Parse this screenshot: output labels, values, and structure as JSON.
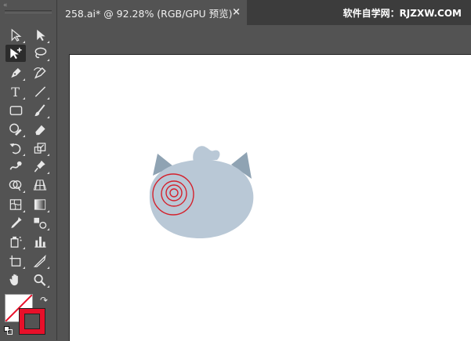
{
  "document_tab": {
    "title": "258.ai* @ 92.28% (RGB/GPU 预览)",
    "close_glyph": "×"
  },
  "watermark": "软件自学网：RJZXW.COM",
  "toolbar": {
    "collapse_glyph": "«",
    "tools": [
      {
        "name": "selection-tool",
        "icon": "arrow-outline-icon",
        "selected": false
      },
      {
        "name": "direct-selection-tool",
        "icon": "arrow-filled-icon",
        "selected": false
      },
      {
        "name": "group-selection-tool",
        "icon": "arrow-plus-icon",
        "selected": true
      },
      {
        "name": "lasso-tool",
        "icon": "lasso-icon",
        "selected": false
      },
      {
        "name": "pen-tool",
        "icon": "pen-icon",
        "selected": false
      },
      {
        "name": "curvature-tool",
        "icon": "curvature-pen-icon",
        "selected": false
      },
      {
        "name": "type-tool",
        "icon": "type-icon",
        "selected": false
      },
      {
        "name": "line-segment-tool",
        "icon": "line-icon",
        "selected": false
      },
      {
        "name": "rectangle-tool",
        "icon": "rectangle-icon",
        "selected": false
      },
      {
        "name": "paintbrush-tool",
        "icon": "brush-icon",
        "selected": false
      },
      {
        "name": "shaper-tool",
        "icon": "shaper-icon",
        "selected": false
      },
      {
        "name": "eraser-tool",
        "icon": "eraser-icon",
        "selected": false
      },
      {
        "name": "rotate-tool",
        "icon": "rotate-icon",
        "selected": false
      },
      {
        "name": "scale-tool",
        "icon": "scale-icon",
        "selected": false
      },
      {
        "name": "warp-tool",
        "icon": "warp-icon",
        "selected": false
      },
      {
        "name": "puppet-warp-tool",
        "icon": "pin-icon",
        "selected": false
      },
      {
        "name": "shape-builder-tool",
        "icon": "shape-builder-icon",
        "selected": false
      },
      {
        "name": "perspective-grid-tool",
        "icon": "perspective-grid-icon",
        "selected": false
      },
      {
        "name": "mesh-tool",
        "icon": "mesh-icon",
        "selected": false
      },
      {
        "name": "gradient-tool",
        "icon": "gradient-icon",
        "selected": false
      },
      {
        "name": "eyedropper-tool",
        "icon": "eyedropper-icon",
        "selected": false
      },
      {
        "name": "blend-tool",
        "icon": "blend-icon",
        "selected": false
      },
      {
        "name": "symbol-sprayer-tool",
        "icon": "symbol-sprayer-icon",
        "selected": false
      },
      {
        "name": "column-graph-tool",
        "icon": "graph-icon",
        "selected": false
      },
      {
        "name": "artboard-tool",
        "icon": "artboard-icon",
        "selected": false
      },
      {
        "name": "slice-tool",
        "icon": "slice-icon",
        "selected": false
      },
      {
        "name": "hand-tool",
        "icon": "hand-icon",
        "selected": false
      },
      {
        "name": "zoom-tool",
        "icon": "zoom-icon",
        "selected": false
      }
    ],
    "fill_color": "#ffffff",
    "stroke_color": "#e8102a",
    "swap_glyph": "↷"
  },
  "colors": {
    "ui_bg": "#535353",
    "tab_bar_bg": "#3c3c3c",
    "artboard": "#ffffff",
    "character_body": "#b9c8d6",
    "character_ear": "#8fa3b3",
    "spiral_stroke": "#d4212c"
  }
}
